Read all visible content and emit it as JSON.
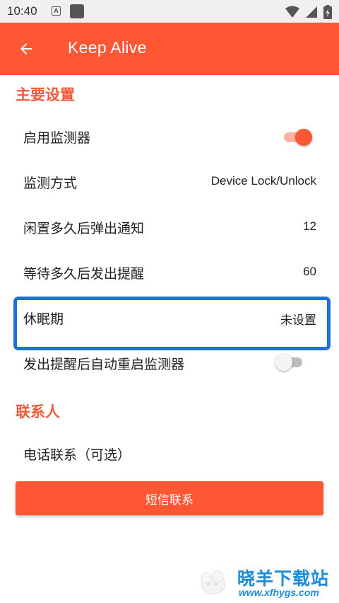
{
  "status_bar": {
    "time": "10:40",
    "notification_icon_letter": "A",
    "icons": [
      "wifi-icon",
      "signal-icon",
      "battery-icon"
    ]
  },
  "app_bar": {
    "title": "Keep Alive",
    "back_icon": "arrow-left-icon",
    "color": "#ff5733"
  },
  "sections": {
    "main_settings": {
      "header": "主要设置",
      "items": {
        "enable_monitor": {
          "title": "启用监测器",
          "switch_on": true
        },
        "monitor_method": {
          "title": "监测方式",
          "value": "Device Lock/Unlock"
        },
        "idle_notify": {
          "title": "闲置多久后弹出通知",
          "value": "12"
        },
        "wait_alert": {
          "title": "等待多久后发出提醒",
          "value": "60"
        },
        "rest_period": {
          "title": "休眠期",
          "value": "未设置",
          "highlighted": true
        },
        "auto_restart": {
          "title": "发出提醒后自动重启监测器",
          "switch_on": false
        }
      }
    },
    "contacts": {
      "header": "联系人",
      "items": {
        "phone_contact": {
          "title": "电话联系（可选）"
        }
      },
      "sms_button_label": "短信联系"
    }
  },
  "watermark": {
    "text_cn": "晓羊下载站",
    "url": "www.xfhygs.com"
  },
  "colors": {
    "accent": "#ff5733",
    "section_header": "#f05a3a",
    "highlight": "#1f6fe0",
    "watermark": "#1a8cd8"
  }
}
